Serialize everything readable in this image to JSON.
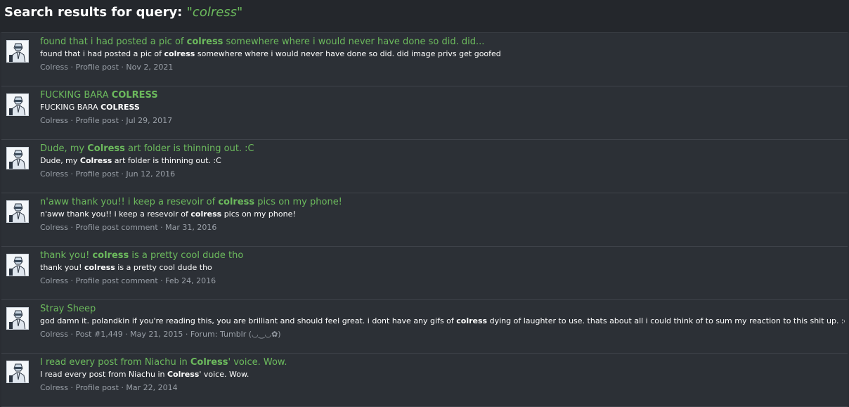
{
  "header": {
    "prefix": "Search results for query: ",
    "query": "\"colress\""
  },
  "results": [
    {
      "title": {
        "pre": "found that i had posted a pic of ",
        "hl": "colress",
        "post": " somewhere where i would never have done so did. did..."
      },
      "snippet": {
        "pre": "found that i had posted a pic of ",
        "hl": "colress",
        "post": " somewhere where i would never have done so did. did image privs get goofed"
      },
      "meta": "Colress · Profile post · Nov 2, 2021"
    },
    {
      "title": {
        "pre": "FUCKING BARA ",
        "hl": "COLRESS",
        "post": ""
      },
      "snippet": {
        "pre": "FUCKING BARA ",
        "hl": "COLRESS",
        "post": ""
      },
      "meta": "Colress · Profile post · Jul 29, 2017"
    },
    {
      "title": {
        "pre": "Dude, my ",
        "hl": "Colress",
        "post": " art folder is thinning out. :C"
      },
      "snippet": {
        "pre": "Dude, my ",
        "hl": "Colress",
        "post": " art folder is thinning out. :C"
      },
      "meta": "Colress · Profile post · Jun 12, 2016"
    },
    {
      "title": {
        "pre": "n'aww thank you!! i keep a resevoir of ",
        "hl": "colress",
        "post": " pics on my phone!"
      },
      "snippet": {
        "pre": "n'aww thank you!! i keep a resevoir of ",
        "hl": "colress",
        "post": " pics on my phone!"
      },
      "meta": "Colress · Profile post comment · Mar 31, 2016"
    },
    {
      "title": {
        "pre": "thank you! ",
        "hl": "colress",
        "post": " is a pretty cool dude tho"
      },
      "snippet": {
        "pre": "thank you! ",
        "hl": "colress",
        "post": " is a pretty cool dude tho"
      },
      "meta": "Colress · Profile post comment · Feb 24, 2016"
    },
    {
      "title": {
        "pre": "Stray Sheep",
        "hl": "",
        "post": ""
      },
      "snippet": {
        "pre": "god damn it. polandkin if you're reading this, you are brilliant and should feel great. i dont have any gifs of ",
        "hl": "colress",
        "post": " dying of laughter to use. thats about all i could think of to sum my reaction to this shit up. :c"
      },
      "meta": "Colress · Post #1,449 · May 21, 2015 · Forum: Tumblr (◡‿◡✿)"
    },
    {
      "title": {
        "pre": "I read every post from Niachu in ",
        "hl": "Colress",
        "post": "' voice. Wow."
      },
      "snippet": {
        "pre": "I read every post from Niachu in ",
        "hl": "Colress",
        "post": "' voice. Wow."
      },
      "meta": "Colress · Profile post · Mar 22, 2014"
    }
  ]
}
